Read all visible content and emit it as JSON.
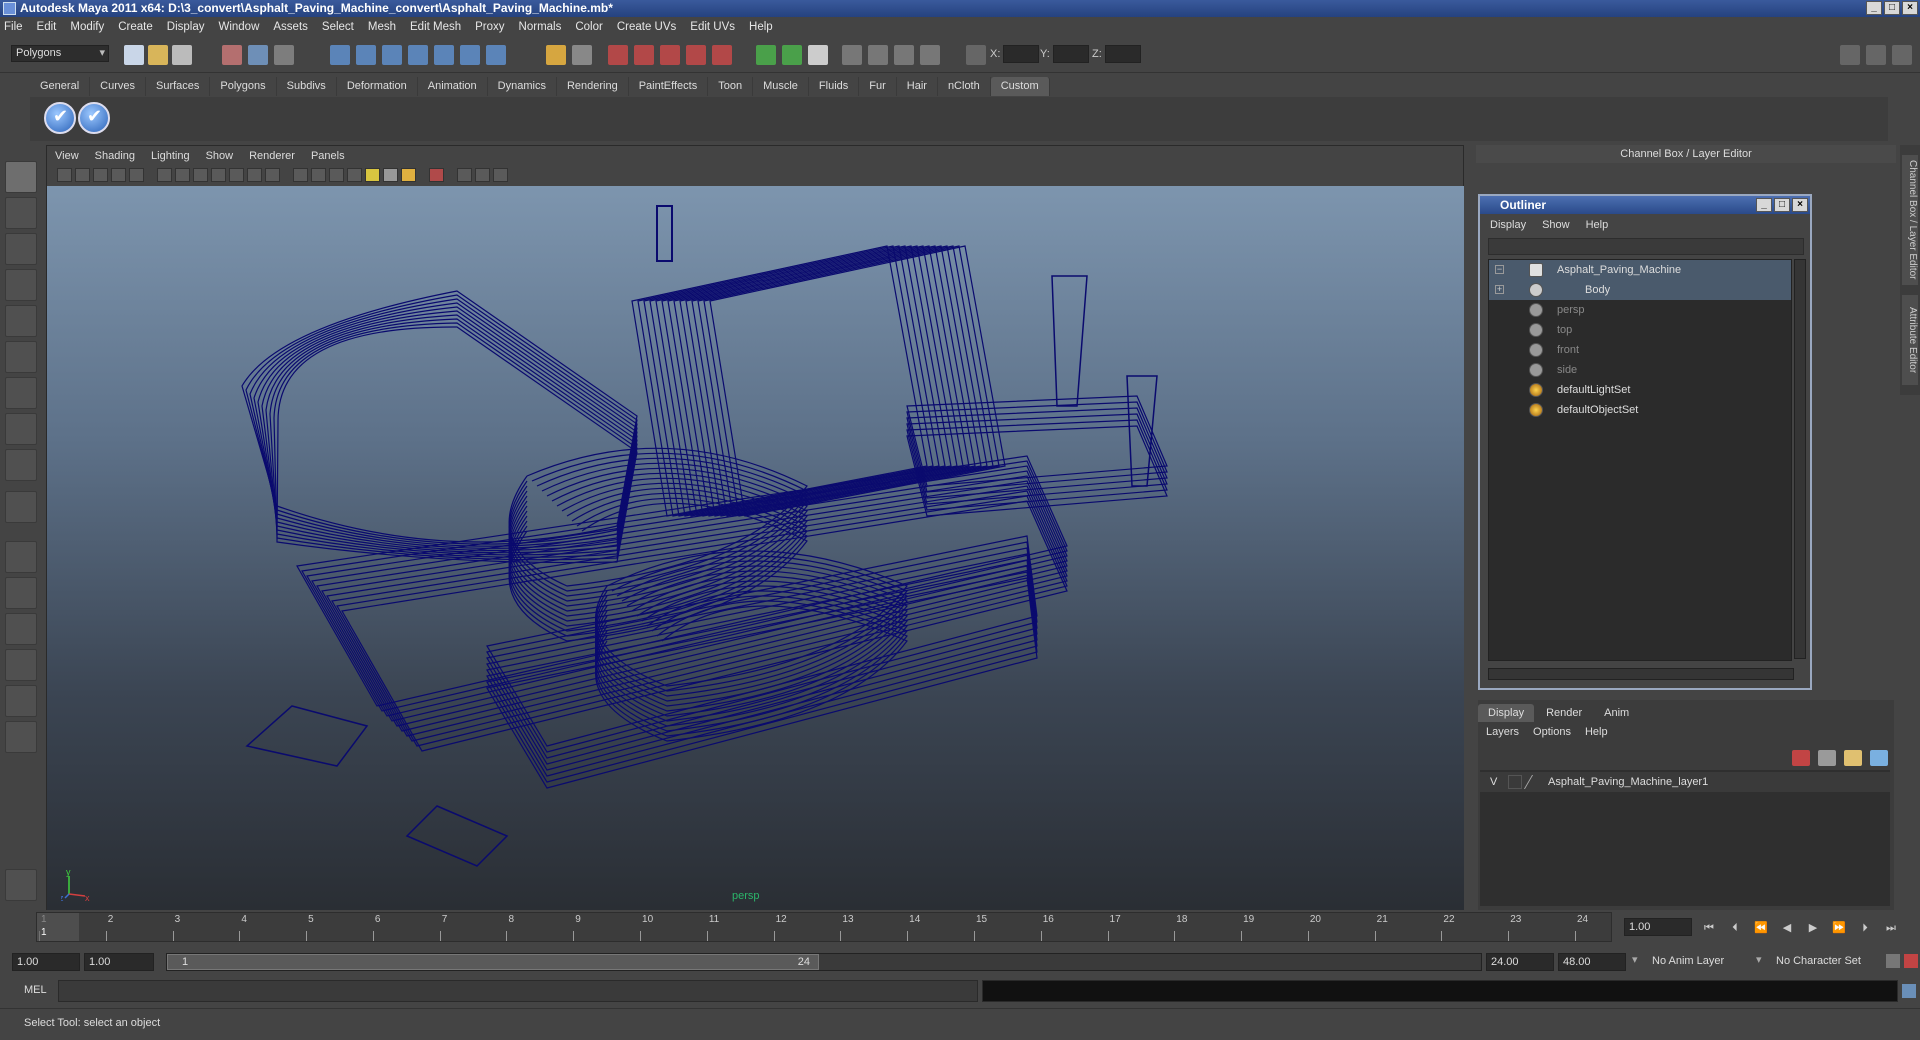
{
  "window": {
    "title": "Autodesk Maya 2011 x64: D:\\3_convert\\Asphalt_Paving_Machine_convert\\Asphalt_Paving_Machine.mb*"
  },
  "menubar": [
    "File",
    "Edit",
    "Modify",
    "Create",
    "Display",
    "Window",
    "Assets",
    "Select",
    "Mesh",
    "Edit Mesh",
    "Proxy",
    "Normals",
    "Color",
    "Create UVs",
    "Edit UVs",
    "Help"
  ],
  "statusline": {
    "mode": "Polygons",
    "x_label": "X:",
    "y_label": "Y:",
    "z_label": "Z:"
  },
  "shelf": {
    "tabs": [
      "General",
      "Curves",
      "Surfaces",
      "Polygons",
      "Subdivs",
      "Deformation",
      "Animation",
      "Dynamics",
      "Rendering",
      "PaintEffects",
      "Toon",
      "Muscle",
      "Fluids",
      "Fur",
      "Hair",
      "nCloth",
      "Custom"
    ],
    "active_tab": "Custom"
  },
  "viewport": {
    "menu": [
      "View",
      "Shading",
      "Lighting",
      "Show",
      "Renderer",
      "Panels"
    ],
    "camera": "persp",
    "axis_y": "y",
    "axis_x": "x",
    "axis_z": "z",
    "wire_color": "#0a0a6e"
  },
  "channel_box": {
    "title": "Channel Box / Layer Editor",
    "side_tabs": [
      "Channel Box / Layer Editor",
      "Attribute Editor"
    ]
  },
  "outliner": {
    "title": "Outliner",
    "menu": [
      "Display",
      "Show",
      "Help"
    ],
    "items": [
      {
        "label": "Asphalt_Paving_Machine",
        "selected": true,
        "expander": "−"
      },
      {
        "label": "Body",
        "selected": true,
        "expander": "+"
      },
      {
        "label": "persp",
        "dim": true
      },
      {
        "label": "top",
        "dim": true
      },
      {
        "label": "front",
        "dim": true
      },
      {
        "label": "side",
        "dim": true
      },
      {
        "label": "defaultLightSet"
      },
      {
        "label": "defaultObjectSet"
      }
    ]
  },
  "layers": {
    "tabs": [
      "Display",
      "Render",
      "Anim"
    ],
    "active_tab": "Display",
    "menu": [
      "Layers",
      "Options",
      "Help"
    ],
    "rows": [
      {
        "visible": "V",
        "name": "Asphalt_Paving_Machine_layer1"
      }
    ]
  },
  "timeline": {
    "ticks": [
      "1",
      "2",
      "3",
      "4",
      "5",
      "6",
      "7",
      "8",
      "9",
      "10",
      "11",
      "12",
      "13",
      "14",
      "15",
      "16",
      "17",
      "18",
      "19",
      "20",
      "21",
      "22",
      "23",
      "24"
    ],
    "current_marker": "1",
    "current_frame": "1.00"
  },
  "range": {
    "start": "1.00",
    "playback_start": "1.00",
    "slider_start": "1",
    "slider_end": "24",
    "playback_end": "24.00",
    "end": "48.00",
    "anim_layer": "No Anim Layer",
    "character_set": "No Character Set"
  },
  "command": {
    "label": "MEL"
  },
  "help": {
    "text": "Select Tool: select an object"
  }
}
